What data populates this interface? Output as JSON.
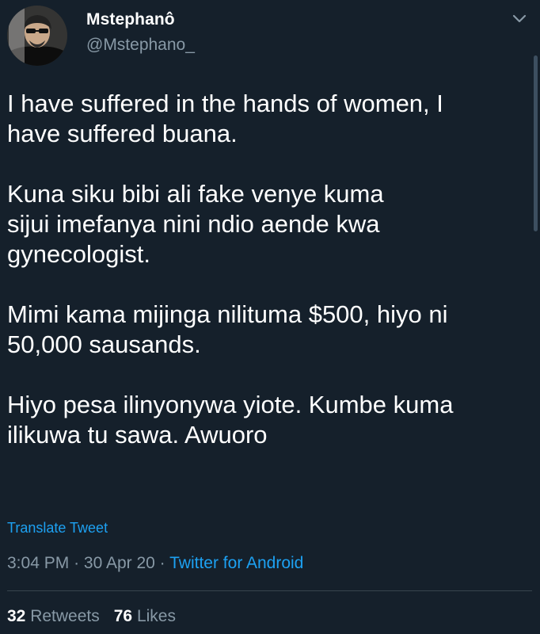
{
  "author": {
    "display_name": "Mstephanô",
    "handle": "@Mstephano_"
  },
  "tweet": {
    "paragraphs": [
      "I have suffered in the hands of women, I\nhave suffered buana.",
      "Kuna siku bibi ali fake venye kuma\nsijui imefanya nini ndio aende kwa\ngynecologist.",
      "Mimi kama mijinga nilituma $500, hiyo ni\n50,000 sausands.",
      "Hiyo pesa ilinyonywa yiote. Kumbe kuma\nilikuwa tu sawa. Awuoro"
    ],
    "translate_label": "Translate Tweet",
    "time": "3:04 PM",
    "separator": "·",
    "date": "30 Apr 20",
    "source": "Twitter for Android"
  },
  "stats": {
    "retweets_count": "32",
    "retweets_label": "Retweets",
    "likes_count": "76",
    "likes_label": "Likes"
  },
  "theme": {
    "background": "#15202b",
    "accent": "#1da1f2",
    "secondary_text": "#8899a6"
  },
  "icons": {
    "menu": "chevron-down-icon"
  }
}
